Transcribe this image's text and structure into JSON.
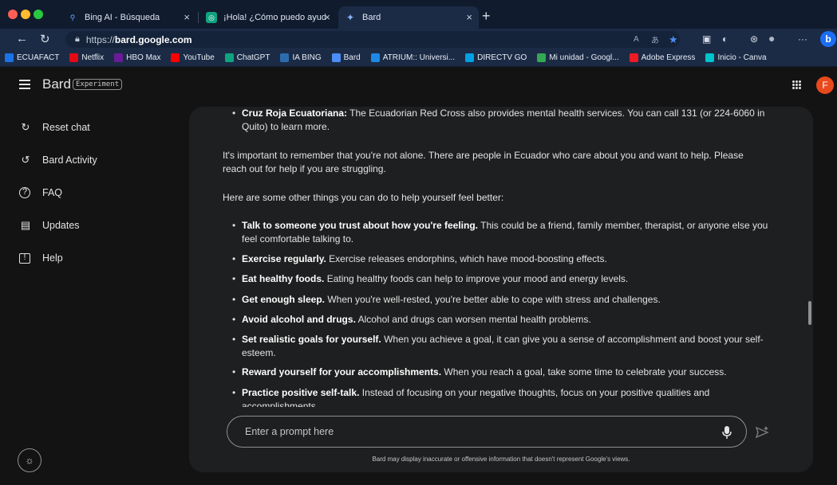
{
  "browser": {
    "tabs": [
      {
        "title": "Bing AI - Búsqueda",
        "favicon": "search-icon",
        "active": false
      },
      {
        "title": "¡Hola! ¿Cómo puedo ayudarte?",
        "favicon": "chatgpt-icon",
        "active": false
      },
      {
        "title": "Bard",
        "favicon": "bard-sparkle-icon",
        "active": true
      }
    ],
    "url_prefix": "https://",
    "url_host": "bard.google.com",
    "bookmarks": [
      {
        "label": "ECUAFACT",
        "color": "#1a73e8"
      },
      {
        "label": "Netflix",
        "color": "#e50914"
      },
      {
        "label": "HBO Max",
        "color": "#6a1b9a"
      },
      {
        "label": "YouTube",
        "color": "#ff0000"
      },
      {
        "label": "ChatGPT",
        "color": "#10a37f"
      },
      {
        "label": "IA BING",
        "color": "#2b6cb0"
      },
      {
        "label": "Bard",
        "color": "#4c8df6"
      },
      {
        "label": "ATRIUM:: Universi...",
        "color": "#1e88e5"
      },
      {
        "label": "DIRECTV GO",
        "color": "#00a1e4"
      },
      {
        "label": "Mi unidad - Googl...",
        "color": "#34a853"
      },
      {
        "label": "Adobe Express",
        "color": "#ed1c24"
      },
      {
        "label": "Inicio - Canva",
        "color": "#00c4cc"
      }
    ]
  },
  "header": {
    "title": "Bard",
    "badge": "Experiment",
    "avatar_letter": "F"
  },
  "sidebar": {
    "items": [
      {
        "label": "Reset chat",
        "icon": "reset-icon"
      },
      {
        "label": "Bard Activity",
        "icon": "history-icon"
      },
      {
        "label": "FAQ",
        "icon": "help-circle-icon"
      },
      {
        "label": "Updates",
        "icon": "calendar-icon"
      },
      {
        "label": "Help",
        "icon": "feedback-icon"
      }
    ]
  },
  "chat": {
    "bullet_top": {
      "bold": "Cruz Roja Ecuatoriana:",
      "text": " The Ecuadorian Red Cross also provides mental health services. You can call 131 (or 224-6060 in Quito) to learn more."
    },
    "para1": "It's important to remember that you're not alone. There are people in Ecuador who care about you and want to help. Please reach out for help if you are struggling.",
    "para2": "Here are some other things you can do to help yourself feel better:",
    "tips": [
      {
        "bold": "Talk to someone you trust about how you're feeling.",
        "text": " This could be a friend, family member, therapist, or anyone else you feel comfortable talking to."
      },
      {
        "bold": "Exercise regularly.",
        "text": " Exercise releases endorphins, which have mood-boosting effects."
      },
      {
        "bold": "Eat healthy foods.",
        "text": " Eating healthy foods can help to improve your mood and energy levels."
      },
      {
        "bold": "Get enough sleep.",
        "text": " When you're well-rested, you're better able to cope with stress and challenges."
      },
      {
        "bold": "Avoid alcohol and drugs.",
        "text": " Alcohol and drugs can worsen mental health problems."
      },
      {
        "bold": "Set realistic goals for yourself.",
        "text": " When you achieve a goal, it can give you a sense of accomplishment and boost your self-esteem."
      },
      {
        "bold": "Reward yourself for your accomplishments.",
        "text": " When you reach a goal, take some time to celebrate your success."
      },
      {
        "bold": "Practice positive self-talk.",
        "text": " Instead of focusing on your negative thoughts, focus on your positive qualities and accomplishments."
      }
    ],
    "input_placeholder": "Enter a prompt here",
    "disclaimer": "Bard may display inaccurate or offensive information that doesn't represent Google's views."
  }
}
